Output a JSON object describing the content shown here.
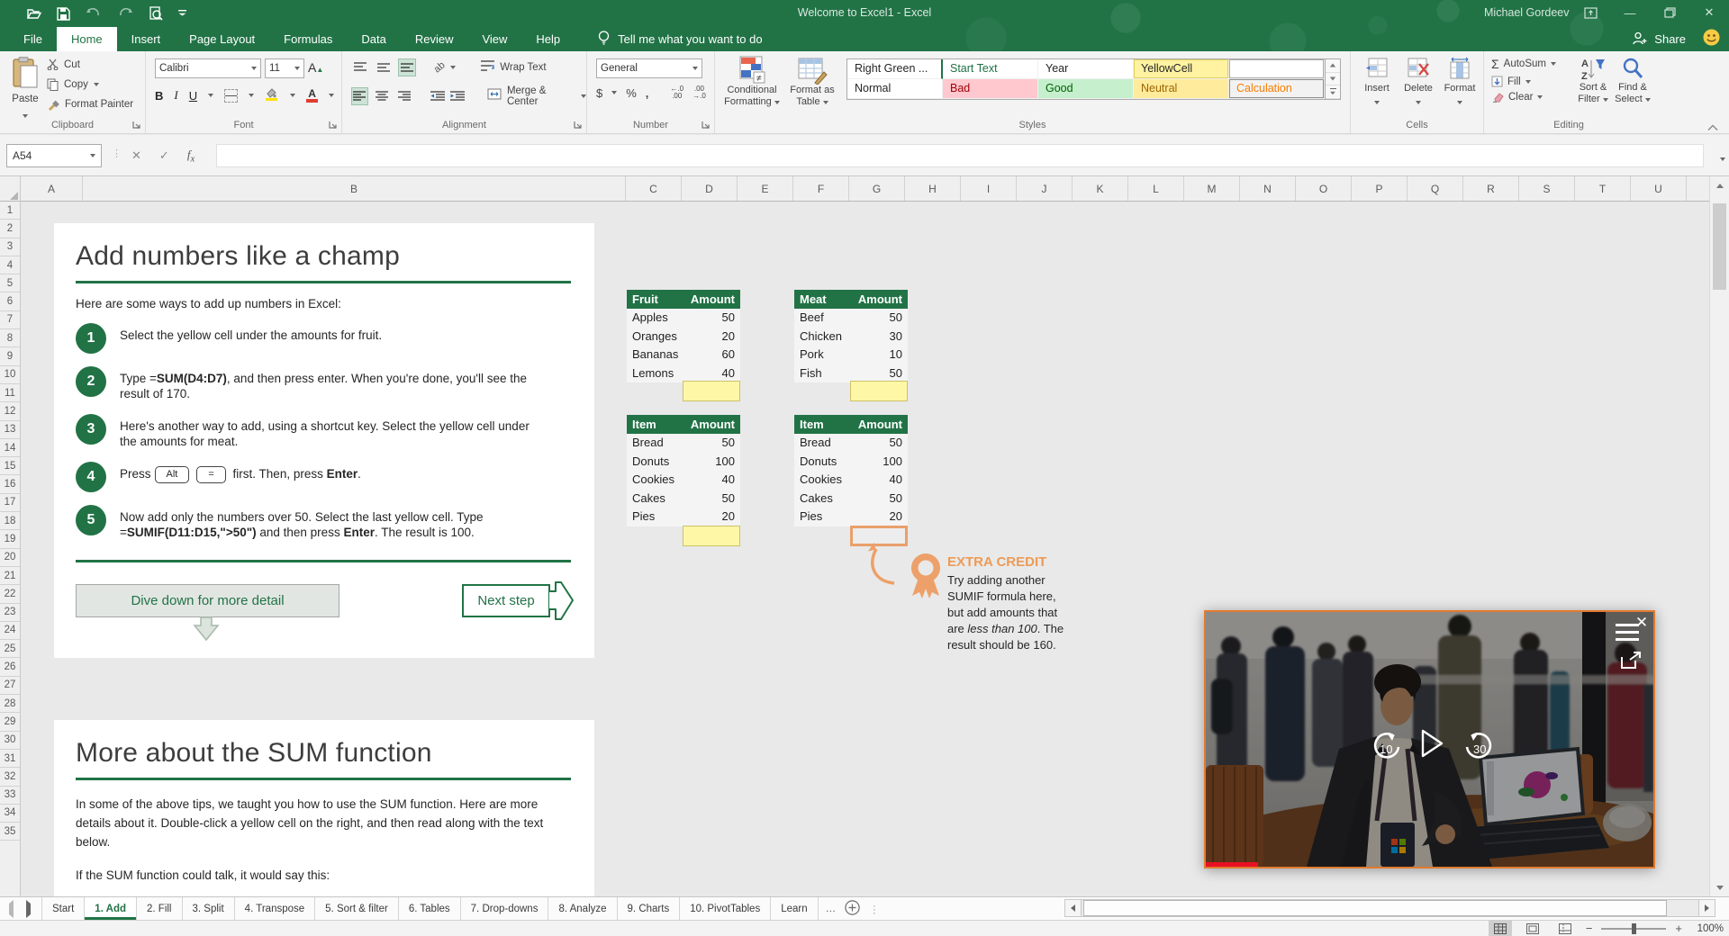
{
  "app": {
    "title": "Welcome to Excel1  -  Excel",
    "user": "Michael Gordeev",
    "share": "Share",
    "tell_me": "Tell me what you want to do"
  },
  "ribbon": {
    "tabs": [
      "File",
      "Home",
      "Insert",
      "Page Layout",
      "Formulas",
      "Data",
      "Review",
      "View",
      "Help"
    ],
    "active_tab": "Home",
    "clipboard": {
      "label": "Clipboard",
      "paste": "Paste",
      "cut": "Cut",
      "copy": "Copy",
      "format_painter": "Format Painter"
    },
    "font": {
      "label": "Font",
      "font_name": "Calibri",
      "font_size": "11",
      "bold": "B",
      "italic": "I",
      "underline": "U"
    },
    "alignment": {
      "label": "Alignment",
      "wrap_text": "Wrap Text",
      "merge_center": "Merge & Center"
    },
    "number": {
      "label": "Number",
      "format": "General"
    },
    "styles": {
      "label": "Styles",
      "conditional_1": "Conditional",
      "conditional_2": "Formatting",
      "format_table_1": "Format as",
      "format_table_2": "Table",
      "gallery": [
        {
          "label": "Right Green ...",
          "fg": "#262626",
          "bg": "#FFFFFF",
          "right_border": "#217346"
        },
        {
          "label": "Start Text",
          "fg": "#1F7145",
          "bg": "#FFFFFF"
        },
        {
          "label": "Year",
          "fg": "#262626",
          "bg": "#FFFFFF"
        },
        {
          "label": "YellowCell",
          "fg": "#262626",
          "bg": "#FFF3A1",
          "border": "#E0CF5E"
        },
        {
          "label": "",
          "fg": "#262626",
          "bg": "#FFFFFF",
          "border": "#ABABAB"
        },
        {
          "label": "Normal",
          "fg": "#262626",
          "bg": "#FFFFFF"
        },
        {
          "label": "Bad",
          "fg": "#9C0006",
          "bg": "#FFC7CE"
        },
        {
          "label": "Good",
          "fg": "#006100",
          "bg": "#C6EFCE"
        },
        {
          "label": "Neutral",
          "fg": "#9C6500",
          "bg": "#FFEB9C"
        },
        {
          "label": "Calculation",
          "fg": "#FA7D00",
          "bg": "#F2F2F2",
          "border": "#8C8C8C"
        }
      ]
    },
    "cells": {
      "label": "Cells",
      "insert": "Insert",
      "delete": "Delete",
      "format": "Format"
    },
    "editing": {
      "label": "Editing",
      "autosum": "AutoSum",
      "fill": "Fill",
      "clear": "Clear",
      "sort_1": "Sort &",
      "sort_2": "Filter",
      "find_1": "Find &",
      "find_2": "Select"
    }
  },
  "formula_bar": {
    "name_box": "A54",
    "formula": ""
  },
  "sheet": {
    "columns": [
      "A",
      "B",
      "C",
      "D",
      "E",
      "F",
      "G",
      "H",
      "I",
      "J",
      "K",
      "L",
      "M",
      "N",
      "O",
      "P",
      "Q",
      "R",
      "S",
      "T",
      "U"
    ],
    "rows": [
      "1",
      "2",
      "3",
      "4",
      "5",
      "6",
      "7",
      "8",
      "9",
      "10",
      "11",
      "12",
      "13",
      "14",
      "15",
      "16",
      "17",
      "18",
      "19",
      "20",
      "21",
      "22",
      "23",
      "24",
      "25",
      "26",
      "27",
      "28",
      "29",
      "30",
      "31",
      "32",
      "33",
      "34",
      "35"
    ]
  },
  "content": {
    "panel1": {
      "title": "Add numbers like a champ",
      "intro": "Here are some ways to add up numbers in Excel:",
      "steps": [
        {
          "n": "1",
          "segments": [
            {
              "t": "Select the yellow cell under the amounts for fruit."
            }
          ]
        },
        {
          "n": "2",
          "segments": [
            {
              "t": "Type ="
            },
            {
              "t": "SUM(D4:D7)",
              "b": true
            },
            {
              "t": ", and then press enter. When you're done, you'll see the result of 170."
            }
          ]
        },
        {
          "n": "3",
          "segments": [
            {
              "t": "Here's another way to add, using a shortcut key. Select the yellow cell under the amounts for meat."
            }
          ]
        },
        {
          "n": "4",
          "segments": [
            {
              "t": "Press"
            },
            {
              "t": "Alt",
              "k": true
            },
            {
              "t": "=",
              "k": true
            },
            {
              "t": " first. Then, press "
            },
            {
              "t": "Enter",
              "b": true
            },
            {
              "t": "."
            }
          ]
        },
        {
          "n": "5",
          "segments": [
            {
              "t": "Now add only the numbers over 50. Select the last yellow cell. Type ="
            },
            {
              "t": "SUMIF(D11:D15,\">50\")",
              "b": true
            },
            {
              "t": " and then press "
            },
            {
              "t": "Enter",
              "b": true
            },
            {
              "t": ". The result is 100."
            }
          ]
        }
      ],
      "dive_button": "Dive down for more detail",
      "next_button": "Next step"
    },
    "panel2": {
      "title": "More about the SUM function",
      "para1": "In some of the above tips, we taught you how to use the SUM function. Here are more details about it. Double-click a yellow cell on the right, and then read along with the text below.",
      "para2": "If the SUM function could talk, it would say this:"
    },
    "extra_credit": {
      "heading": "EXTRA CREDIT",
      "segments": [
        {
          "t": "Try adding another SUMIF formula here, but add amounts that are "
        },
        {
          "t": "less than 100",
          "i": true
        },
        {
          "t": ". The result should be 160."
        }
      ]
    }
  },
  "tables": {
    "fruit": {
      "headers": [
        "Fruit",
        "Amount"
      ],
      "rows": [
        [
          "Apples",
          "50"
        ],
        [
          "Oranges",
          "20"
        ],
        [
          "Bananas",
          "60"
        ],
        [
          "Lemons",
          "40"
        ]
      ]
    },
    "meat": {
      "headers": [
        "Meat",
        "Amount"
      ],
      "rows": [
        [
          "Beef",
          "50"
        ],
        [
          "Chicken",
          "30"
        ],
        [
          "Pork",
          "10"
        ],
        [
          "Fish",
          "50"
        ]
      ]
    },
    "items1": {
      "headers": [
        "Item",
        "Amount"
      ],
      "rows": [
        [
          "Bread",
          "50"
        ],
        [
          "Donuts",
          "100"
        ],
        [
          "Cookies",
          "40"
        ],
        [
          "Cakes",
          "50"
        ],
        [
          "Pies",
          "20"
        ]
      ]
    },
    "items2": {
      "headers": [
        "Item",
        "Amount"
      ],
      "rows": [
        [
          "Bread",
          "50"
        ],
        [
          "Donuts",
          "100"
        ],
        [
          "Cookies",
          "40"
        ],
        [
          "Cakes",
          "50"
        ],
        [
          "Pies",
          "20"
        ]
      ]
    }
  },
  "video": {
    "skip_back": "10",
    "skip_forward": "30"
  },
  "sheet_tabs": {
    "tabs": [
      "Start",
      "1. Add",
      "2. Fill",
      "3. Split",
      "4. Transpose",
      "5. Sort & filter",
      "6. Tables",
      "7. Drop-downs",
      "8. Analyze",
      "9. Charts",
      "10. PivotTables",
      "Learn"
    ],
    "active": "1. Add",
    "overflow": "…"
  },
  "status_bar": {
    "zoom": "100%"
  },
  "colors": {
    "accent": "#217346",
    "orange": "#ED9B56",
    "yellow_cell": "#FEF8A6",
    "bad_bg": "#FFC7CE",
    "good_bg": "#C6EFCE",
    "neutral_bg": "#FFEB9C"
  }
}
